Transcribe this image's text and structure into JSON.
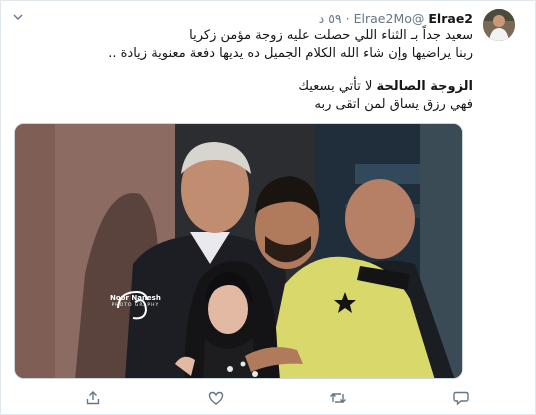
{
  "tweet": {
    "author_name": "Elrae2",
    "author_handle": "@Elrae2Mo",
    "separator": "·",
    "timestamp": "٥٩ د",
    "lines": [
      "سعيد جداً بـ الثناء اللي حصلت عليه زوجة مؤمن زكريا",
      "ربنا يراضيها وإن شاء الله الكلام الجميل ده يديها دفعة معنوية زيادة ..",
      "لا تأتي بسعيك",
      "فهي رزق يساق لمن اتقى ربه"
    ],
    "bold_phrase": "الزوجة الصالحة",
    "media": {
      "watermark_name": "Noor Nanesh",
      "watermark_sub": "PHOTO GRAPHY"
    }
  },
  "icons": {
    "caret": "chevron-down-icon",
    "share": "share-icon",
    "like": "heart-icon",
    "retweet": "retweet-icon",
    "reply": "reply-icon"
  },
  "colors": {
    "text": "#14171a",
    "secondary": "#657786",
    "border": "#e1e8ed",
    "background": "#e6ecf0"
  }
}
